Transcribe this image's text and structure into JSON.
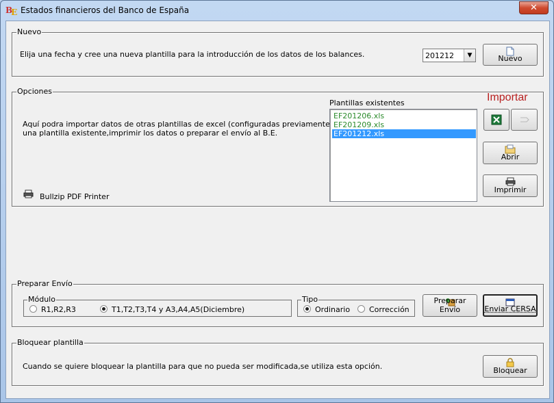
{
  "window": {
    "title": "Estados financieros del Banco de España",
    "close_glyph": "✕"
  },
  "nuevo": {
    "legend": "Nuevo",
    "description": "Elija una fecha y cree una nueva plantilla para la introducción de los datos de los balances.",
    "date_value": "201212",
    "button_label": "Nuevo"
  },
  "opciones": {
    "legend": "Opciones",
    "description_line1": "Aquí podra importar datos de otras plantillas de excel (configuradas previamente),abrir",
    "description_line2": "una plantilla existente,imprimir los datos o preparar el envío al B.E.",
    "printer_name": "Bullzip PDF Printer",
    "list_label": "Plantillas existentes",
    "files": [
      "EF201206.xls",
      "EF201209.xls",
      "EF201212.xls"
    ],
    "selected_file": "EF201212.xls",
    "importar_label": "Importar",
    "abrir_label": "Abrir",
    "imprimir_label": "Imprimir"
  },
  "preparar": {
    "legend": "Preparar Envío",
    "modulo_legend": "Módulo",
    "modulo_options": [
      "R1,R2,R3",
      "T1,T2,T3,T4 y A3,A4,A5(Diciembre)"
    ],
    "modulo_selected": "T1,T2,T3,T4 y A3,A4,A5(Diciembre)",
    "tipo_legend": "Tipo",
    "tipo_options": [
      "Ordinario",
      "Corrección"
    ],
    "tipo_selected": "Ordinario",
    "preparar_button": "Preparar Envío",
    "enviar_button": "Enviar CERSA"
  },
  "bloquear": {
    "legend": "Bloquear plantilla",
    "description": "Cuando se quiere bloquear la plantilla para que no pueda ser modificada,se utiliza esta opción.",
    "button_label": "Bloquear"
  },
  "colors": {
    "file_text": "#2a8a2a",
    "selection": "#3399ff",
    "importar": "#b81f1f"
  }
}
